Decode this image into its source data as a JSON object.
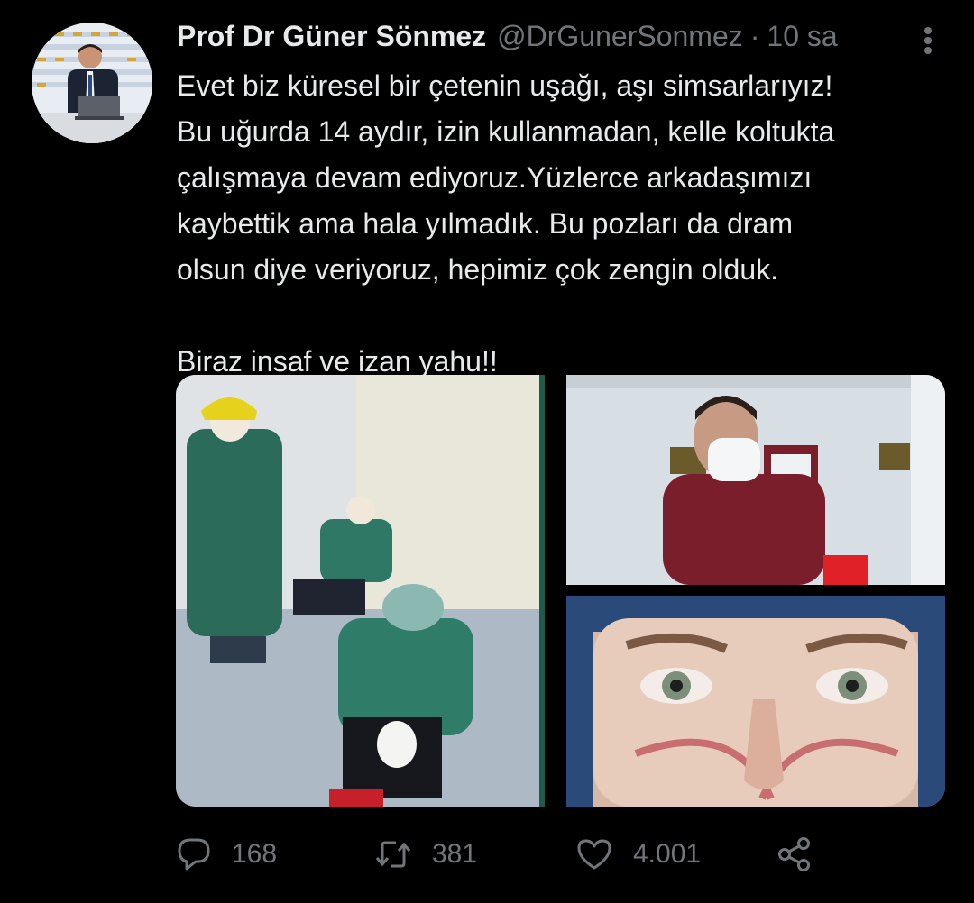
{
  "tweet": {
    "author_name": "Prof Dr Güner Sönmez",
    "author_handle": "@DrGunerSonmez",
    "separator": "·",
    "timestamp": "10 sa",
    "text_lines": [
      "Evet biz küresel bir çetenin uşağı, aşı simsarlarıyız!",
      "Bu uğurda 14 aydır, izin kullanmadan, kelle koltukta",
      "çalışmaya devam ediyoruz.Yüzlerce arkadaşımızı",
      "kaybettik ama hala yılmadık. Bu pozları da dram",
      "olsun diye veriyoruz, hepimiz çok zengin olduk."
    ],
    "text_last_line": "Biraz insaf ve izan yahu!!",
    "media_count": 3
  },
  "actions": {
    "reply_count": "168",
    "retweet_count": "381",
    "like_count": "4.001"
  },
  "icons": {
    "reply": "reply-icon",
    "retweet": "retweet-icon",
    "like": "heart-icon",
    "share": "share-icon",
    "more": "more-options-icon"
  },
  "colors": {
    "background": "#000000",
    "text": "#e7e9ea",
    "secondary": "#71767b"
  }
}
